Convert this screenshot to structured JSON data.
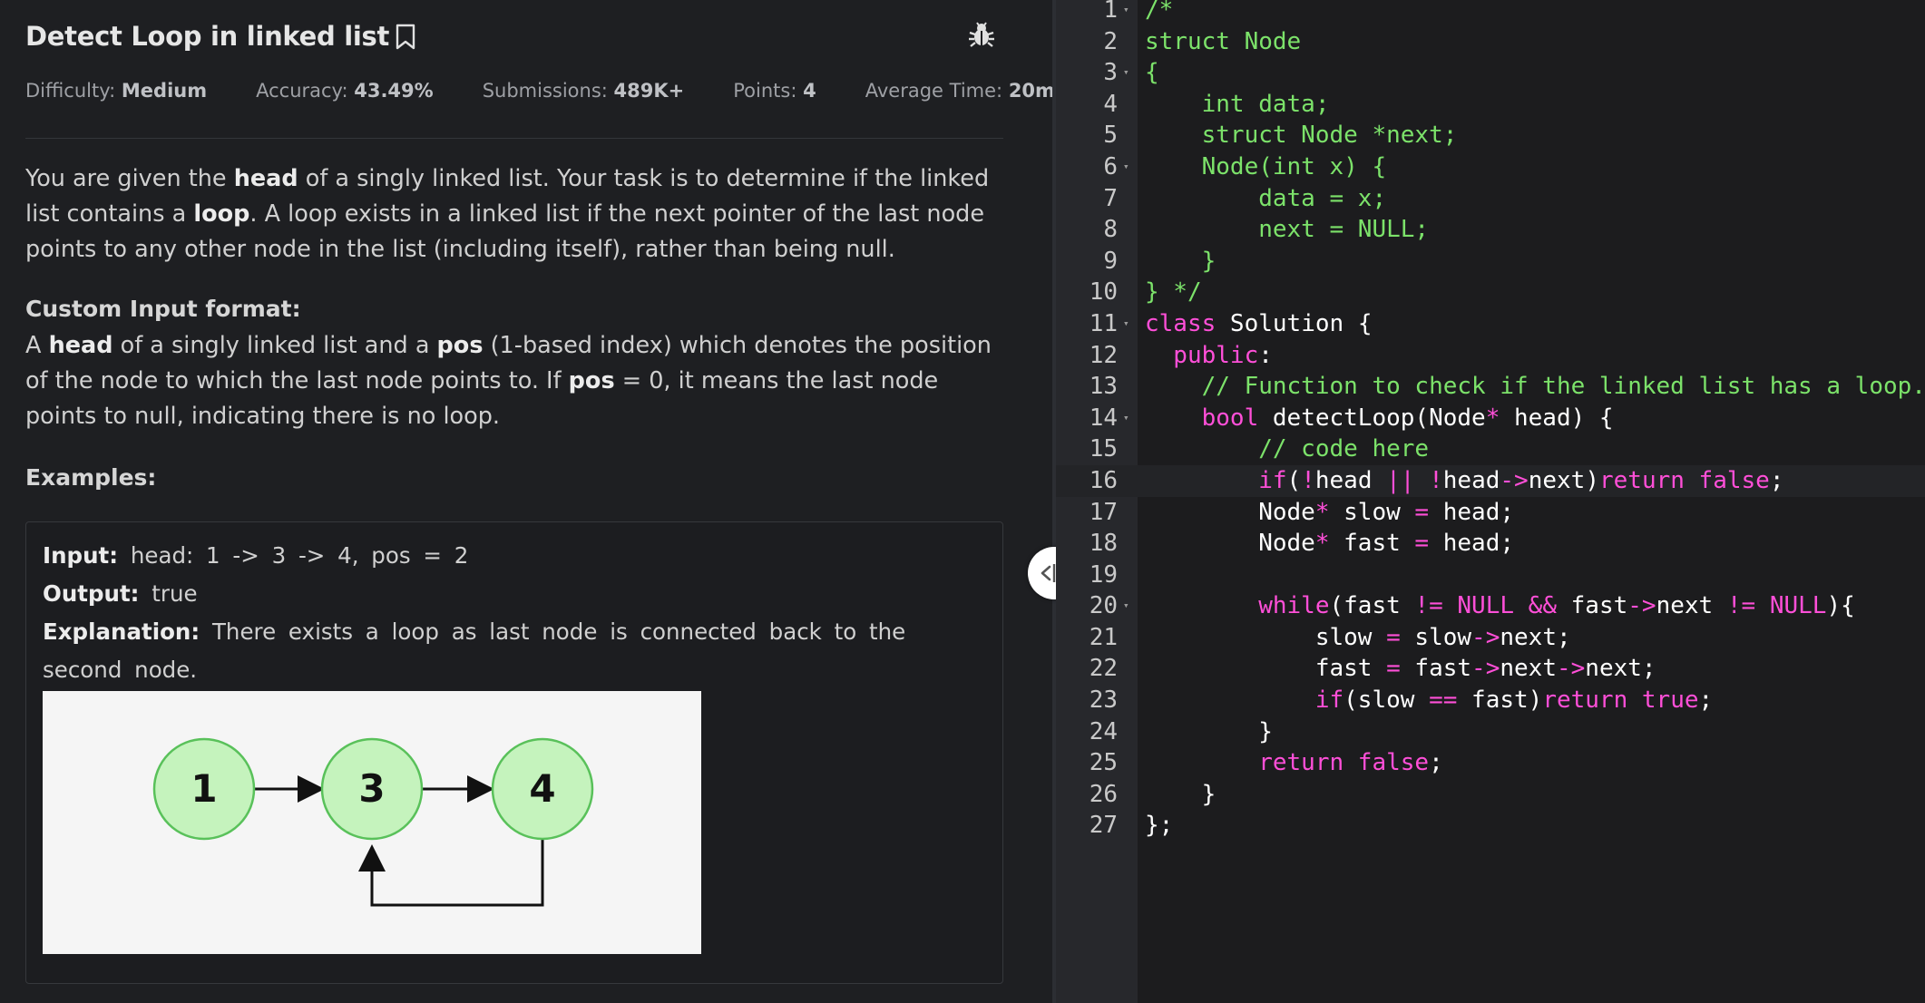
{
  "problem": {
    "title": "Detect Loop in linked list",
    "meta": [
      {
        "label": "Difficulty:",
        "value": "Medium"
      },
      {
        "label": "Accuracy:",
        "value": "43.49%"
      },
      {
        "label": "Submissions:",
        "value": "489K+"
      },
      {
        "label": "Points:",
        "value": "4"
      },
      {
        "label": "Average Time:",
        "value": "20m"
      }
    ],
    "description": {
      "p1": "You are given the ",
      "p1_b1": "head",
      "p2": " of a singly linked list. Your task is to determine if the linked list contains a ",
      "p2_b2": "loop",
      "p3": ". A loop exists in a linked list if the next pointer of the last node points to any other node in the list (including itself), rather than being null."
    },
    "custom_input": {
      "heading": "Custom Input format:",
      "s1": "A ",
      "b1": "head",
      "s2": " of a singly linked list and a ",
      "b2": "pos",
      "s3": " (1-based index) which denotes the position of the node to which the last node points to. If ",
      "b3": "pos",
      "s4": " = 0, it means the last node points to null, indicating there is no loop."
    },
    "examples_heading": "Examples:",
    "example": {
      "input_label": "Input:",
      "input_value": "head: 1 -> 3 -> 4, pos = 2",
      "output_label": "Output:",
      "output_value": "true",
      "explanation_label": "Explanation:",
      "explanation_value": "There exists a loop as last node is connected back to the",
      "explanation_value_2": "second node.",
      "diagram_nodes": [
        "1",
        "3",
        "4"
      ]
    },
    "icons": {
      "bookmark": "bookmark-icon",
      "bug": "bug-icon"
    }
  },
  "splitter": {
    "icon": "split-drag-icon"
  },
  "editor": {
    "active_line": 16,
    "lines": [
      {
        "n": "1",
        "fold": true
      },
      {
        "n": "2"
      },
      {
        "n": "3",
        "fold": true
      },
      {
        "n": "4"
      },
      {
        "n": "5"
      },
      {
        "n": "6",
        "fold": true
      },
      {
        "n": "7"
      },
      {
        "n": "8"
      },
      {
        "n": "9"
      },
      {
        "n": "10"
      },
      {
        "n": "11",
        "fold": true
      },
      {
        "n": "12"
      },
      {
        "n": "13"
      },
      {
        "n": "14",
        "fold": true
      },
      {
        "n": "15"
      },
      {
        "n": "16"
      },
      {
        "n": "17"
      },
      {
        "n": "18"
      },
      {
        "n": "19"
      },
      {
        "n": "20",
        "fold": true
      },
      {
        "n": "21"
      },
      {
        "n": "22"
      },
      {
        "n": "23"
      },
      {
        "n": "24"
      },
      {
        "n": "25"
      },
      {
        "n": "26"
      },
      {
        "n": "27"
      }
    ],
    "code": [
      [
        [
          "c",
          "/*"
        ]
      ],
      [
        [
          "c",
          "struct Node"
        ]
      ],
      [
        [
          "c",
          "{"
        ]
      ],
      [
        [
          "c",
          "    int data;"
        ]
      ],
      [
        [
          "c",
          "    struct Node *next;"
        ]
      ],
      [
        [
          "c",
          "    Node(int x) {"
        ]
      ],
      [
        [
          "c",
          "        data = x;"
        ]
      ],
      [
        [
          "c",
          "        next = NULL;"
        ]
      ],
      [
        [
          "c",
          "    }"
        ]
      ],
      [
        [
          "c",
          "} */"
        ]
      ],
      [
        [
          "k",
          "class"
        ],
        [
          "p",
          " Solution {"
        ]
      ],
      [
        [
          "k",
          "  public"
        ],
        [
          "p",
          ":"
        ]
      ],
      [
        [
          "c",
          "    // Function to check if the linked list has a loop."
        ]
      ],
      [
        [
          "k",
          "    bool"
        ],
        [
          "p",
          " detectLoop(Node"
        ],
        [
          "o",
          "*"
        ],
        [
          "p",
          " head) {"
        ]
      ],
      [
        [
          "c",
          "        // code here"
        ]
      ],
      [
        [
          "k",
          "        if"
        ],
        [
          "p",
          "("
        ],
        [
          "o",
          "!"
        ],
        [
          "p",
          "head "
        ],
        [
          "o",
          "||"
        ],
        [
          "p",
          " "
        ],
        [
          "o",
          "!"
        ],
        [
          "p",
          "head"
        ],
        [
          "o",
          "->"
        ],
        [
          "p",
          "next)"
        ],
        [
          "k",
          "return false"
        ],
        [
          "p",
          ";"
        ]
      ],
      [
        [
          "p",
          "        Node"
        ],
        [
          "o",
          "*"
        ],
        [
          "p",
          " slow "
        ],
        [
          "o",
          "="
        ],
        [
          "p",
          " head;"
        ]
      ],
      [
        [
          "p",
          "        Node"
        ],
        [
          "o",
          "*"
        ],
        [
          "p",
          " fast "
        ],
        [
          "o",
          "="
        ],
        [
          "p",
          " head;"
        ]
      ],
      [
        [
          "p",
          ""
        ]
      ],
      [
        [
          "k",
          "        while"
        ],
        [
          "p",
          "(fast "
        ],
        [
          "o",
          "!="
        ],
        [
          "p",
          " "
        ],
        [
          "k",
          "NULL"
        ],
        [
          "p",
          " "
        ],
        [
          "o",
          "&&"
        ],
        [
          "p",
          " fast"
        ],
        [
          "o",
          "->"
        ],
        [
          "p",
          "next "
        ],
        [
          "o",
          "!="
        ],
        [
          "p",
          " "
        ],
        [
          "k",
          "NULL"
        ],
        [
          "p",
          "){"
        ]
      ],
      [
        [
          "p",
          "            slow "
        ],
        [
          "o",
          "="
        ],
        [
          "p",
          " slow"
        ],
        [
          "o",
          "->"
        ],
        [
          "p",
          "next;"
        ]
      ],
      [
        [
          "p",
          "            fast "
        ],
        [
          "o",
          "="
        ],
        [
          "p",
          " fast"
        ],
        [
          "o",
          "->"
        ],
        [
          "p",
          "next"
        ],
        [
          "o",
          "->"
        ],
        [
          "p",
          "next;"
        ]
      ],
      [
        [
          "k",
          "            if"
        ],
        [
          "p",
          "(slow "
        ],
        [
          "o",
          "=="
        ],
        [
          "p",
          " fast)"
        ],
        [
          "k",
          "return true"
        ],
        [
          "p",
          ";"
        ]
      ],
      [
        [
          "p",
          "        }"
        ]
      ],
      [
        [
          "k",
          "        return false"
        ],
        [
          "p",
          ";"
        ]
      ],
      [
        [
          "p",
          "    }"
        ]
      ],
      [
        [
          "p",
          "};"
        ]
      ]
    ]
  }
}
